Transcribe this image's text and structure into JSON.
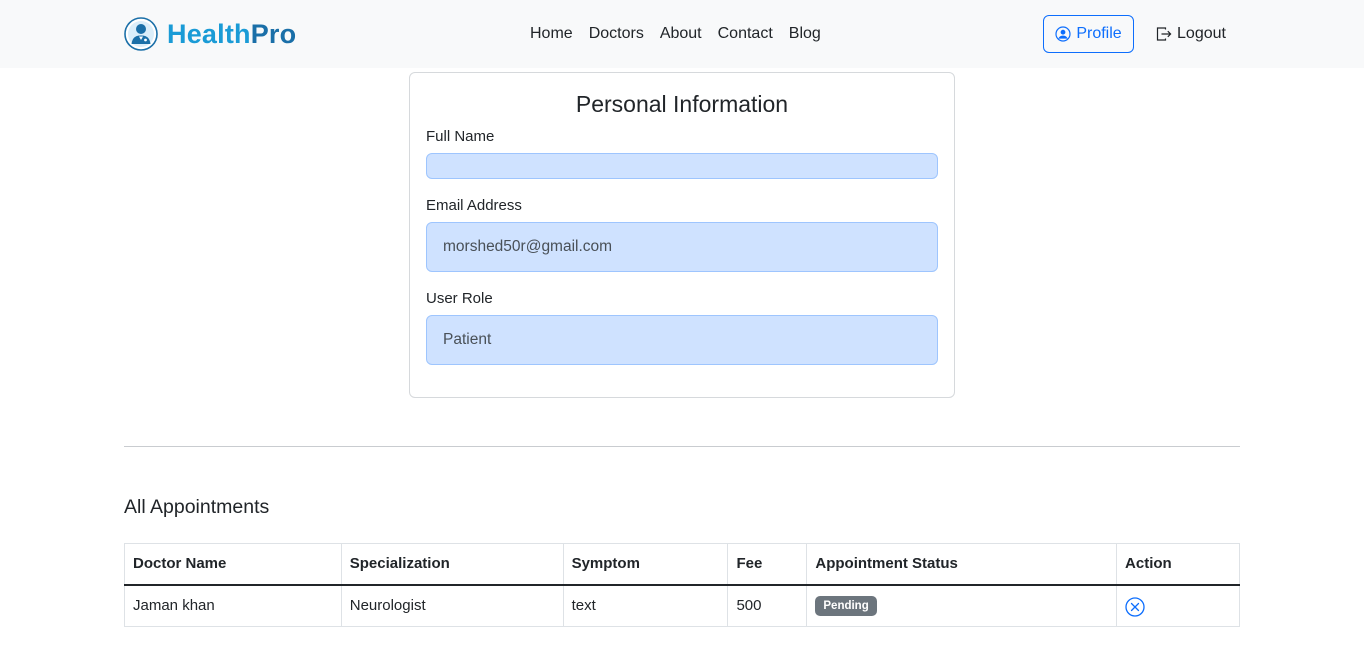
{
  "brand": {
    "name_part1": "Health",
    "name_part2": "Pro",
    "logo_icon": "doctor-avatar-icon"
  },
  "nav": {
    "links": [
      "Home",
      "Doctors",
      "About",
      "Contact",
      "Blog"
    ],
    "profile_label": "Profile",
    "logout_label": "Logout"
  },
  "personal_info": {
    "title": "Personal Information",
    "full_name_label": "Full Name",
    "full_name_value": "",
    "email_label": "Email Address",
    "email_value": "morshed50r@gmail.com",
    "role_label": "User Role",
    "role_value": "Patient"
  },
  "appointments": {
    "title": "All Appointments",
    "columns": [
      "Doctor Name",
      "Specialization",
      "Symptom",
      "Fee",
      "Appointment Status",
      "Action"
    ],
    "rows": [
      {
        "doctor": "Jaman khan",
        "specialization": "Neurologist",
        "symptom": "text",
        "fee": "500",
        "status": "Pending",
        "action_icon": "cancel-circle-icon"
      }
    ]
  },
  "colors": {
    "primary": "#0d6efd",
    "brand_light": "#1a9bd6",
    "brand_dark": "#1a6fa8",
    "input_bg": "#cfe2ff",
    "badge_secondary": "#6c757d",
    "navbar_bg": "#f8f9fa"
  }
}
